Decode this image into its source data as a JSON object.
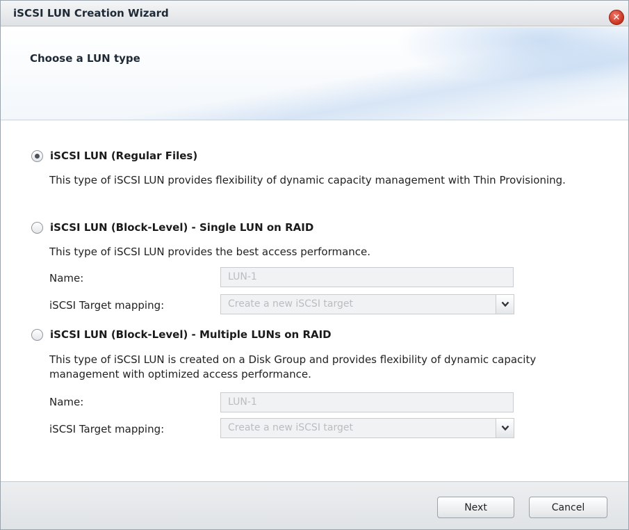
{
  "window": {
    "title": "iSCSI LUN Creation Wizard",
    "close_glyph": "✕"
  },
  "header": {
    "heading": "Choose a LUN type"
  },
  "options": [
    {
      "label": "iSCSI LUN (Regular Files)",
      "selected": true,
      "description": "This type of iSCSI LUN provides flexibility of dynamic capacity management with Thin Provisioning."
    },
    {
      "label": "iSCSI LUN (Block-Level) - Single LUN on RAID",
      "selected": false,
      "description": "This type of iSCSI LUN provides the best access performance.",
      "name_label": "Name:",
      "name_value": "LUN-1",
      "mapping_label": "iSCSI Target mapping:",
      "mapping_value": "Create a new iSCSI target"
    },
    {
      "label": "iSCSI LUN (Block-Level) - Multiple LUNs on RAID",
      "selected": false,
      "description": "This type of iSCSI LUN is created on a Disk Group and provides flexibility of dynamic capacity management with optimized access performance.",
      "name_label": "Name:",
      "name_value": "LUN-1",
      "mapping_label": "iSCSI Target mapping:",
      "mapping_value": "Create a new iSCSI target"
    }
  ],
  "footer": {
    "next_label": "Next",
    "cancel_label": "Cancel"
  },
  "icons": {
    "close": "close-icon",
    "dropdown": "chevron-down-icon"
  },
  "colors": {
    "close_button": "#c8321f",
    "disabled_text": "#b9bdc1"
  }
}
